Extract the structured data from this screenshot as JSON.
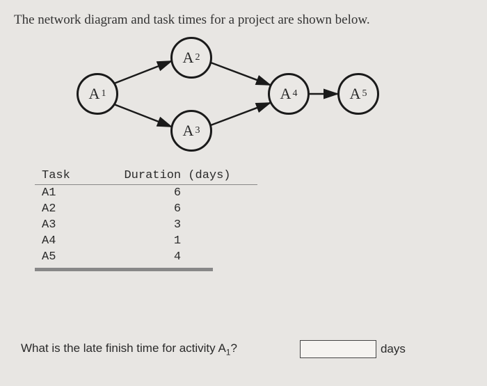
{
  "intro_text": "The network diagram and task times for a project are shown below.",
  "nodes": {
    "a1": {
      "base": "A",
      "sub": "1"
    },
    "a2": {
      "base": "A",
      "sub": "2"
    },
    "a3": {
      "base": "A",
      "sub": "3"
    },
    "a4": {
      "base": "A",
      "sub": "4"
    },
    "a5": {
      "base": "A",
      "sub": "5"
    }
  },
  "table": {
    "headers": {
      "task": "Task",
      "duration": "Duration (days)"
    },
    "rows": [
      {
        "task": "A1",
        "duration": "6"
      },
      {
        "task": "A2",
        "duration": "6"
      },
      {
        "task": "A3",
        "duration": "3"
      },
      {
        "task": "A4",
        "duration": "1"
      },
      {
        "task": "A5",
        "duration": "4"
      }
    ]
  },
  "question": {
    "prefix": "What is the late finish time for activity A",
    "subscript": "1",
    "suffix": "?",
    "answer_value": "",
    "unit": "days"
  },
  "chart_data": {
    "type": "network-diagram",
    "nodes": [
      "A1",
      "A2",
      "A3",
      "A4",
      "A5"
    ],
    "edges": [
      {
        "from": "A1",
        "to": "A2"
      },
      {
        "from": "A1",
        "to": "A3"
      },
      {
        "from": "A2",
        "to": "A4"
      },
      {
        "from": "A3",
        "to": "A4"
      },
      {
        "from": "A4",
        "to": "A5"
      }
    ],
    "durations_days": {
      "A1": 6,
      "A2": 6,
      "A3": 3,
      "A4": 1,
      "A5": 4
    }
  }
}
